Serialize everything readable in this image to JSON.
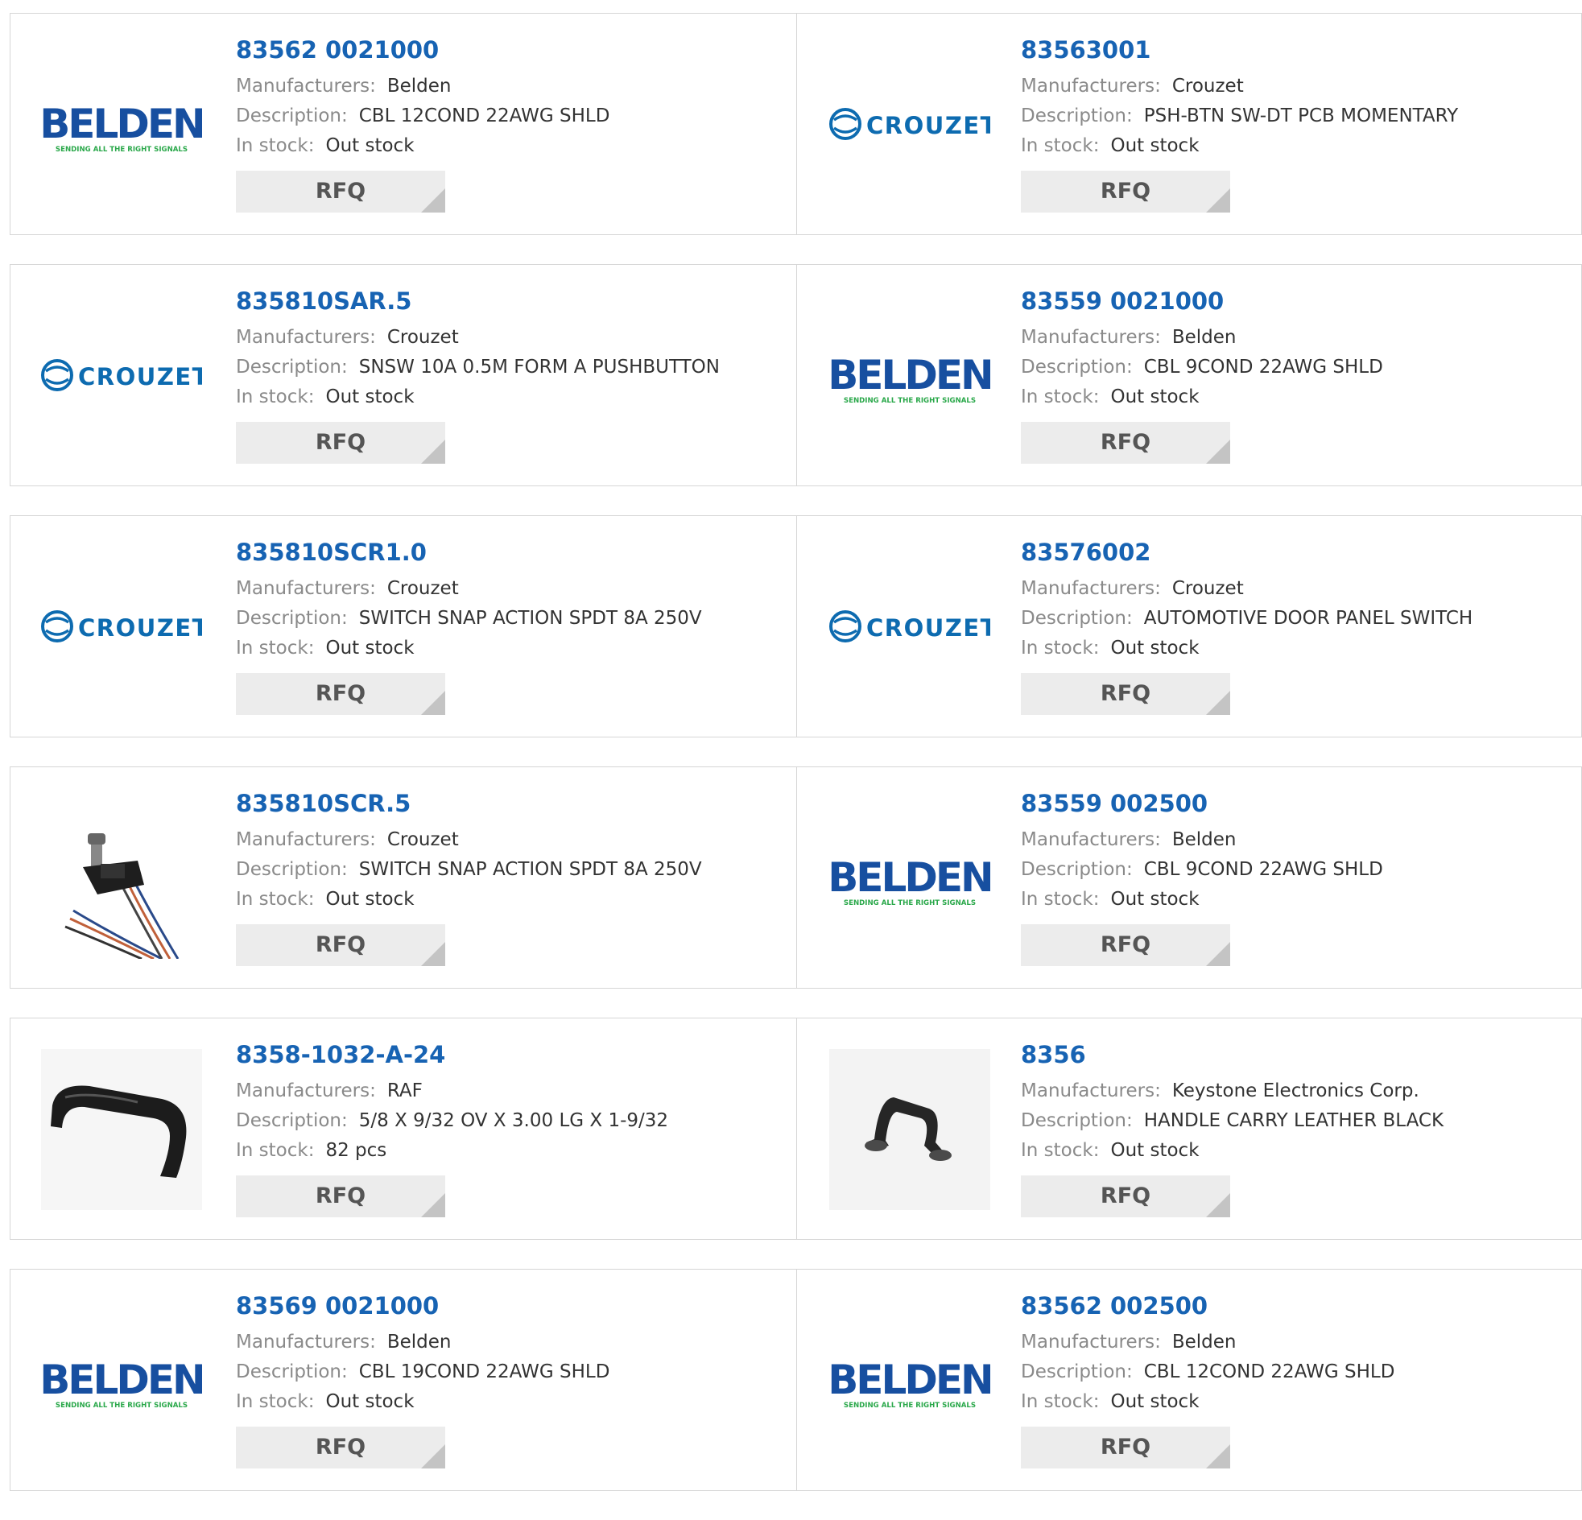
{
  "labels": {
    "manufacturers": "Manufacturers:",
    "description": "Description:",
    "in_stock": "In stock:",
    "rfq": "RFQ"
  },
  "logos": {
    "belden_word": "BELDEN",
    "belden_tagline": "SENDING ALL THE RIGHT SIGNALS",
    "crouzet_word": "CROUZET"
  },
  "colors": {
    "link": "#1763b3",
    "belden_blue": "#174fa0",
    "belden_green": "#2aa84a",
    "crouzet_blue": "#0d6bb0"
  },
  "products": [
    {
      "part": "83562 0021000",
      "manufacturer": "Belden",
      "description": "CBL 12COND 22AWG SHLD",
      "stock": "Out stock",
      "image": "belden-logo"
    },
    {
      "part": "83563001",
      "manufacturer": "Crouzet",
      "description": "PSH-BTN SW-DT PCB MOMENTARY",
      "stock": "Out stock",
      "image": "crouzet-logo"
    },
    {
      "part": "835810SAR.5",
      "manufacturer": "Crouzet",
      "description": "SNSW 10A 0.5M FORM A PUSHBUTTON",
      "stock": "Out stock",
      "image": "crouzet-logo"
    },
    {
      "part": "83559 0021000",
      "manufacturer": "Belden",
      "description": "CBL 9COND 22AWG SHLD",
      "stock": "Out stock",
      "image": "belden-logo"
    },
    {
      "part": "835810SCR1.0",
      "manufacturer": "Crouzet",
      "description": "SWITCH SNAP ACTION SPDT 8A 250V",
      "stock": "Out stock",
      "image": "crouzet-logo"
    },
    {
      "part": "83576002",
      "manufacturer": "Crouzet",
      "description": "AUTOMOTIVE DOOR PANEL SWITCH",
      "stock": "Out stock",
      "image": "crouzet-logo"
    },
    {
      "part": "835810SCR.5",
      "manufacturer": "Crouzet",
      "description": "SWITCH SNAP ACTION SPDT 8A 250V",
      "stock": "Out stock",
      "image": "switch-photo"
    },
    {
      "part": "83559 002500",
      "manufacturer": "Belden",
      "description": "CBL 9COND 22AWG SHLD",
      "stock": "Out stock",
      "image": "belden-logo"
    },
    {
      "part": "8358-1032-A-24",
      "manufacturer": "RAF",
      "description": "5/8 X 9/32 OV X 3.00 LG X 1-9/32",
      "stock": "82 pcs",
      "image": "handle-photo"
    },
    {
      "part": "8356",
      "manufacturer": "Keystone Electronics Corp.",
      "description": "HANDLE CARRY LEATHER BLACK",
      "stock": "Out stock",
      "image": "carry-handle-photo"
    },
    {
      "part": "83569 0021000",
      "manufacturer": "Belden",
      "description": "CBL 19COND 22AWG SHLD",
      "stock": "Out stock",
      "image": "belden-logo"
    },
    {
      "part": "83562 002500",
      "manufacturer": "Belden",
      "description": "CBL 12COND 22AWG SHLD",
      "stock": "Out stock",
      "image": "belden-logo"
    }
  ]
}
